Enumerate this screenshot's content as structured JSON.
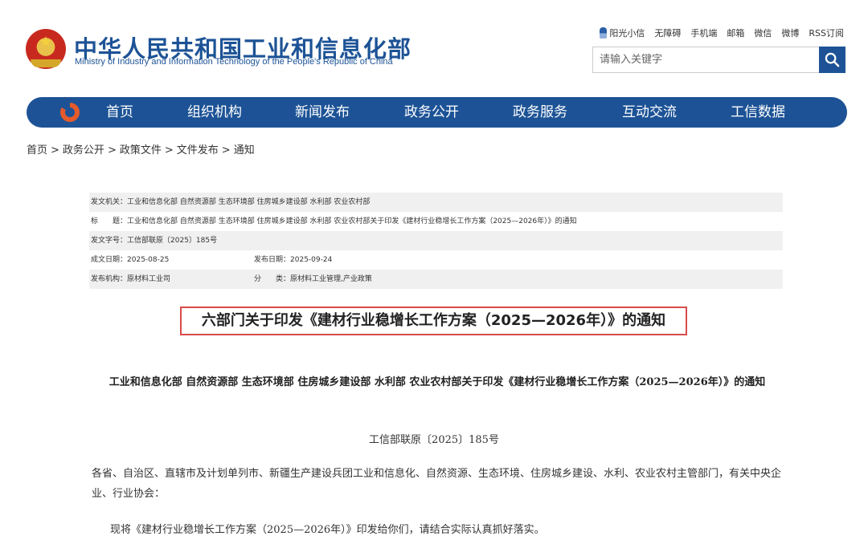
{
  "header": {
    "title": "中华人民共和国工业和信息化部",
    "subtitle": "Ministry of Industry and Information Technology of the People's Republic of China",
    "toplinks": [
      "阳光小信",
      "无障碍",
      "手机端",
      "邮箱",
      "微信",
      "微博",
      "RSS订阅"
    ],
    "search_placeholder": "请输入关键字"
  },
  "nav": [
    "首页",
    "组织机构",
    "新闻发布",
    "政务公开",
    "政务服务",
    "互动交流",
    "工信数据"
  ],
  "breadcrumb": [
    "首页",
    "政务公开",
    "政策文件",
    "文件发布",
    "通知"
  ],
  "info": {
    "issuer_label": "发文机关：",
    "issuer": "工业和信息化部 自然资源部 生态环境部 住房城乡建设部 水利部 农业农村部",
    "title_label": "标　　题：",
    "title": "工业和信息化部 自然资源部 生态环境部 住房城乡建设部 水利部 农业农村部关于印发《建材行业稳增长工作方案（2025—2026年）》的通知",
    "docno_label": "发文字号：",
    "docno": "工信部联原〔2025〕185号",
    "created_label": "成文日期：",
    "created": "2025-08-25",
    "published_label": "发布日期：",
    "published": "2025-09-24",
    "org_label": "发布机构：",
    "org": "原材料工业司",
    "category_label": "分　　类：",
    "category": "原材料工业管理,产业政策"
  },
  "main_title": "六部门关于印发《建材行业稳增长工作方案（2025—2026年）》的通知",
  "doc": {
    "heading": "工业和信息化部 自然资源部 生态环境部 住房城乡建设部 水利部 农业农村部关于印发《建材行业稳增长工作方案（2025—2026年）》的通知",
    "number": "工信部联原〔2025〕185号",
    "para1": "各省、自治区、直辖市及计划单列市、新疆生产建设兵团工业和信息化、自然资源、生态环境、住房城乡建设、水利、农业农村主管部门，有关中央企业、行业协会：",
    "para2": "现将《建材行业稳增长工作方案（2025—2026年）》印发给你们，请结合实际认真抓好落实。"
  }
}
